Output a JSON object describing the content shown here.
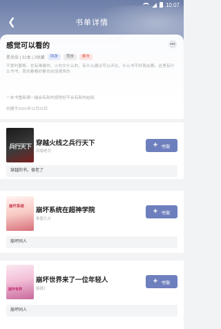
{
  "status_bar": {
    "time": "10:07"
  },
  "nav": {
    "title": "书单详情"
  },
  "booklist": {
    "name": "感觉可以看的",
    "meta": "星尚朵 | 31本 | 2收藏",
    "tags": [
      "网游",
      "竞技",
      "都市"
    ],
    "description": "不爱时菱断、也有难看的、小白文什么的、有什么建议可以评论、什么书不好我会删，这里有什么书书，我也看看好看也出加速来的",
    "note": "一本书重新满一遍会有新的感悟但不会有新的结局.",
    "created": "创建于2021年11月22日"
  },
  "books": [
    {
      "title": "穿越火线之兵行天下",
      "author": "风暗老司",
      "cover_text": "兵行天下",
      "add_label": "书架",
      "comment": "穿越的书，很老了"
    },
    {
      "title": "崩坏系统在超神学院",
      "author": "象窗九分",
      "cover_text": "崩坏系统",
      "add_label": "书架",
      "comment": "崩坏同人"
    },
    {
      "title": "崩坏世界来了一位年轻人",
      "author": "裂缝1",
      "cover_text": "崩坏世界",
      "add_label": "书架",
      "comment": "崩坏同人"
    }
  ]
}
